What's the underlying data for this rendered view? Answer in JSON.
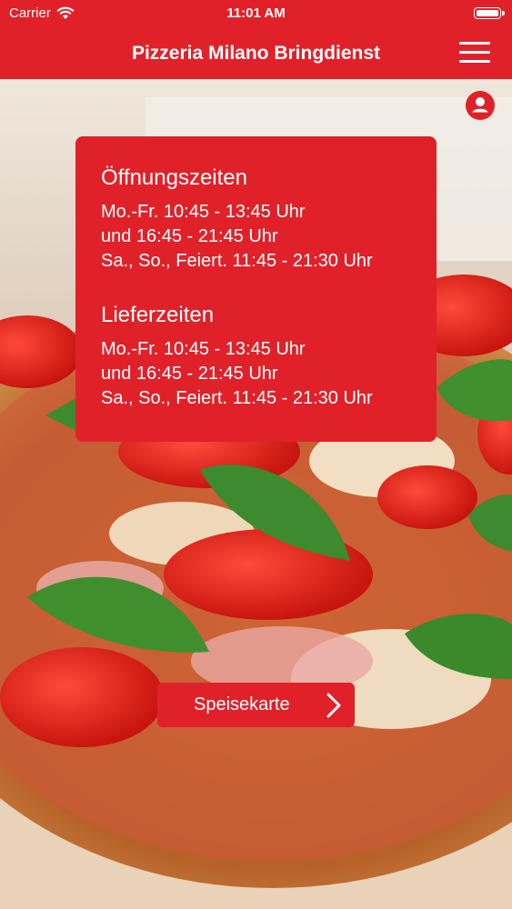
{
  "status_bar": {
    "carrier": "Carrier",
    "time": "11:01 AM"
  },
  "nav": {
    "title": "Pizzeria Milano Bringdienst"
  },
  "icons": {
    "wifi": "wifi-icon",
    "battery": "battery-icon",
    "menu": "hamburger-menu-icon",
    "user": "user-icon",
    "chevron": "chevron-right-icon"
  },
  "hours": {
    "opening_title": "Öffnungszeiten",
    "opening_lines": [
      "Mo.-Fr. 10:45 - 13:45 Uhr",
      "und 16:45 - 21:45 Uhr",
      "Sa., So., Feiert. 11:45 - 21:30 Uhr"
    ],
    "delivery_title": "Lieferzeiten",
    "delivery_lines": [
      "Mo.-Fr. 10:45 - 13:45 Uhr",
      "und 16:45 - 21:45 Uhr",
      "Sa., So., Feiert. 11:45 - 21:30 Uhr"
    ]
  },
  "menu_button": {
    "label": "Speisekarte"
  },
  "colors": {
    "brand_red": "#e0212a",
    "text_on_red": "#ffffff"
  }
}
